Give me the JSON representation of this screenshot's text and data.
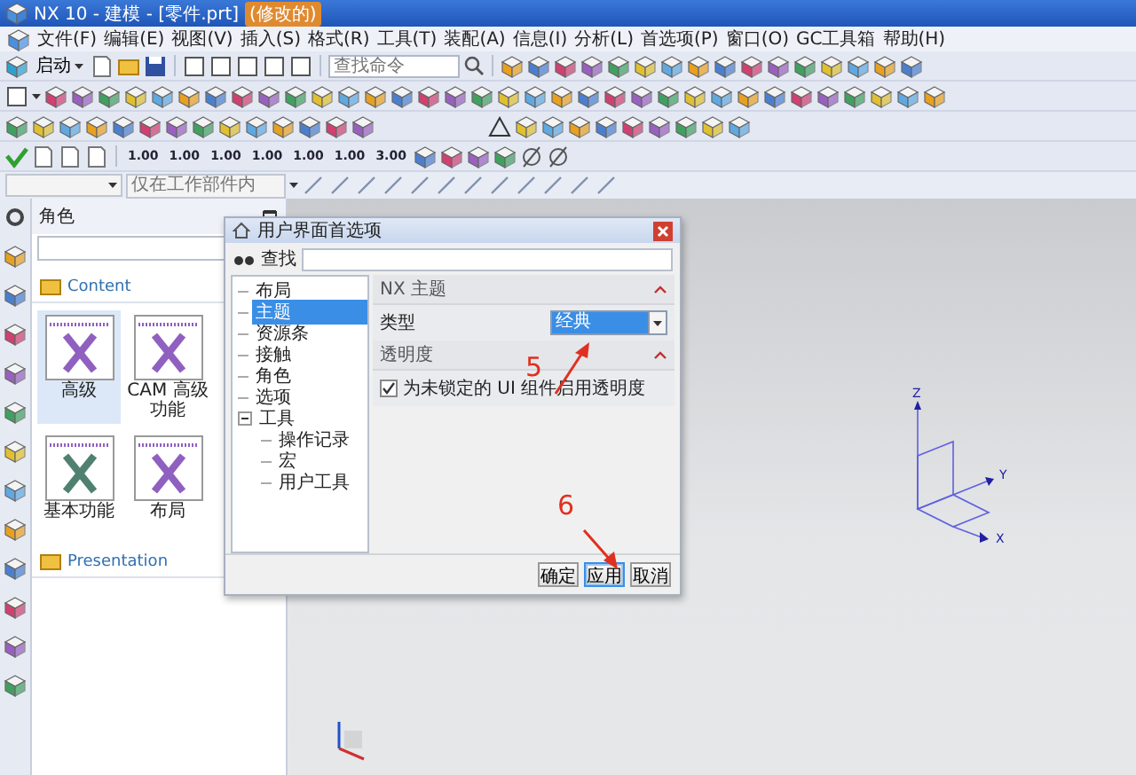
{
  "window": {
    "title": "NX 10 - 建模 - [零件.prt]",
    "badge": "(修改的)"
  },
  "menu": [
    "文件(F)",
    "编辑(E)",
    "视图(V)",
    "插入(S)",
    "格式(R)",
    "工具(T)",
    "装配(A)",
    "信息(I)",
    "分析(L)",
    "首选项(P)",
    "窗口(O)",
    "GC工具箱",
    "帮助(H)"
  ],
  "toolbar": {
    "start_button": "启动",
    "command_search": {
      "placeholder": "查找命令"
    },
    "dimension_buttons": [
      "1.00",
      "1.00",
      "1.00",
      "1.00",
      "1.00",
      "1.00",
      "3.00"
    ]
  },
  "selection_bar": {
    "filter_dropdown": {
      "placeholder": "仅在工作部件内"
    }
  },
  "resource_panel": {
    "title": "角色",
    "sections": [
      {
        "title": "Content",
        "items": [
          {
            "label": "高级",
            "selected": true
          },
          {
            "label": "CAM 高级功能",
            "selected": false
          },
          {
            "label": "基本功能",
            "selected": false
          },
          {
            "label": "布局",
            "selected": false
          }
        ]
      },
      {
        "title": "Presentation"
      }
    ]
  },
  "dialog": {
    "title": "用户界面首选项",
    "search_label": "查找",
    "tree": [
      {
        "label": "布局",
        "selected": false
      },
      {
        "label": "主题",
        "selected": true
      },
      {
        "label": "资源条",
        "selected": false
      },
      {
        "label": "接触",
        "selected": false
      },
      {
        "label": "角色",
        "selected": false
      },
      {
        "label": "选项",
        "selected": false
      },
      {
        "label": "工具",
        "selected": false,
        "expanded": true,
        "children": [
          {
            "label": "操作记录",
            "selected": false
          },
          {
            "label": "宏",
            "selected": false
          },
          {
            "label": "用户工具",
            "selected": false
          }
        ]
      }
    ],
    "sections": [
      {
        "title": "NX 主题",
        "expanded": true,
        "kind": "dropdown",
        "label": "类型",
        "value": "经典"
      },
      {
        "title": "透明度",
        "expanded": true,
        "kind": "checkbox",
        "label": "为未锁定的 UI 组件启用透明度",
        "checked": true
      }
    ],
    "buttons": [
      {
        "label": "确定",
        "focused": false
      },
      {
        "label": "应用",
        "focused": true
      },
      {
        "label": "取消",
        "focused": false
      }
    ]
  },
  "annotations": [
    {
      "label": "5"
    },
    {
      "label": "6"
    }
  ],
  "viewport": {
    "wcs_labels": [
      "Z",
      "Y",
      "X"
    ]
  }
}
